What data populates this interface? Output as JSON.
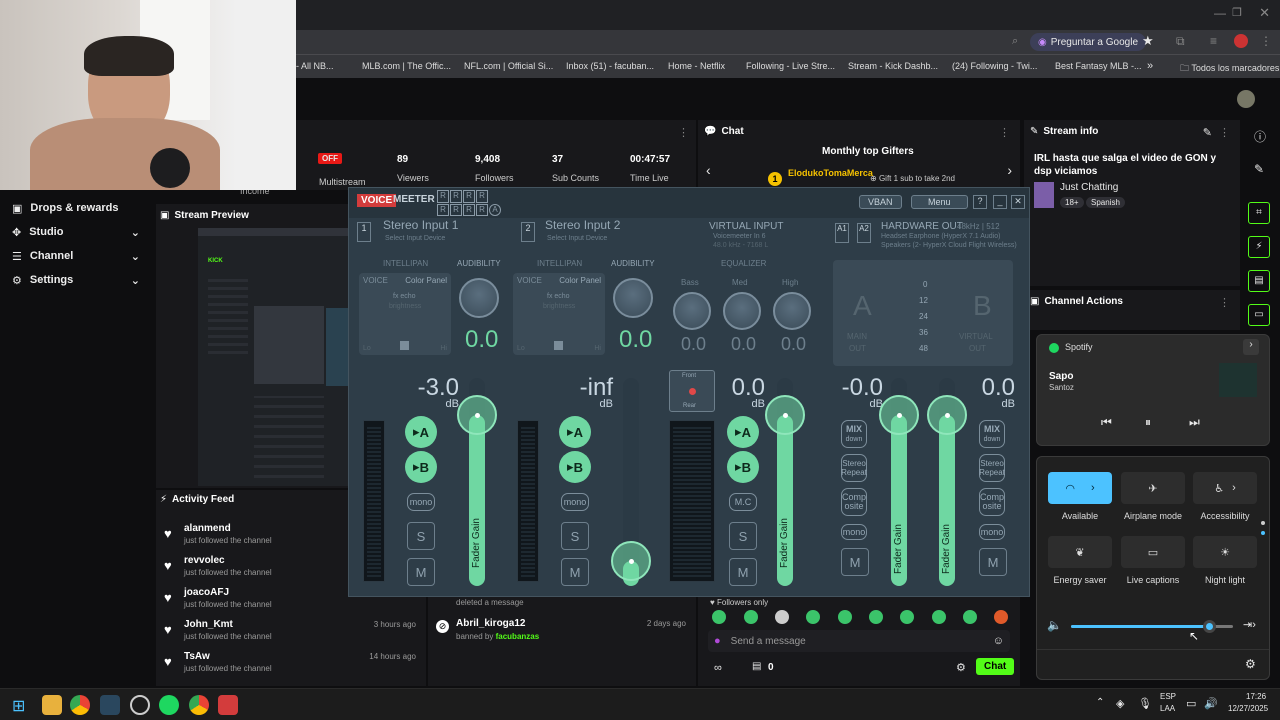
{
  "browser": {
    "ask_google": "Preguntar a Google",
    "bookmarks": [
      "- All NB...",
      "MLB.com | The Offic...",
      "NFL.com | Official Si...",
      "Inbox (51) - facuban...",
      "Home - Netflix",
      "Following - Live Stre...",
      "Stream - Kick Dashb...",
      "(24) Following - Twi...",
      "Best Fantasy MLB -..."
    ],
    "all_bookmarks": "Todos los marcadores"
  },
  "stats": {
    "income_label": "Income",
    "off_badge": "OFF",
    "multistream_label": "Multistream",
    "viewers_value": "89",
    "viewers_label": "Viewers",
    "followers_value": "9,408",
    "followers_label": "Followers",
    "subs_value": "37",
    "subs_label": "Sub Counts",
    "time_value": "00:47:57",
    "time_label": "Time Live"
  },
  "sidebar": {
    "items": [
      {
        "label": "Drops & rewards"
      },
      {
        "label": "Studio"
      },
      {
        "label": "Channel"
      },
      {
        "label": "Settings"
      }
    ]
  },
  "stream_preview": {
    "title": "Stream Preview"
  },
  "activity_feed": {
    "title": "Activity Feed",
    "items": [
      {
        "user": "alanmend",
        "action": "just followed the channel",
        "time": ""
      },
      {
        "user": "revvolec",
        "action": "just followed the channel",
        "time": ""
      },
      {
        "user": "joacoAFJ",
        "action": "just followed the channel",
        "time": ""
      },
      {
        "user": "John_Kmt",
        "action": "just followed the channel",
        "time": "3 hours ago"
      },
      {
        "user": "TsAw",
        "action": "just followed the channel",
        "time": "14 hours ago"
      }
    ]
  },
  "mod_log": {
    "deleted": "deleted a message",
    "user": "Abril_kiroga12",
    "time": "2 days ago",
    "banned_by": "banned by",
    "moderator": "facubanzas"
  },
  "chat": {
    "title": "Chat",
    "gifters_title": "Monthly top Gifters",
    "top_gifter": "ElodukoTomaMerca",
    "gift_hint": "Gift 1 sub to take 2nd",
    "followers_only": "Followers only",
    "placeholder": "Send a message",
    "points": "0",
    "send_label": "Chat"
  },
  "stream_info": {
    "title": "Stream info",
    "stream_title": "IRL hasta que salga el video de GON y dsp viciamos",
    "category": "Just Chatting",
    "tags": [
      "18+",
      "Spanish"
    ]
  },
  "channel_actions": {
    "title": "Channel Actions"
  },
  "voicemeeter": {
    "logo_a": "VOICE",
    "logo_b": "MEETER",
    "vban": "VBAN",
    "menu": "Menu",
    "inputs": [
      {
        "num": "1",
        "name": "Stereo Input 1",
        "sub": "Select Input Device",
        "db": "-3.0",
        "level": 0.82
      },
      {
        "num": "2",
        "name": "Stereo Input 2",
        "sub": "Select Input Device",
        "db": "-inf",
        "level": 0.12
      }
    ],
    "virtual_input": {
      "title": "VIRTUAL INPUT",
      "line1": "Voicemeeter In 6",
      "line2": "48.0 kHz - 7168 L",
      "db": "0.0",
      "level": 0.82
    },
    "hardware_out": {
      "title": "HARDWARE OUT",
      "spec": "48kHz | 512",
      "line1": "Headset Earphone (HyperX 7.1 Audio)",
      "line2": "Speakers (2- HyperX Cloud Flight Wireless)"
    },
    "outputs": [
      {
        "db": "-0.0",
        "level": 0.82
      },
      {
        "db": "0.0",
        "level": 0.82
      }
    ],
    "labels": {
      "intellipan": "INTELLIPAN",
      "audibility": "AUDIBILITY",
      "equalizer": "EQUALIZER",
      "voice": "VOICE",
      "color_panel": "Color Panel",
      "fx_echo": "fx echo",
      "brightness": "brightness",
      "lo": "Lo",
      "hi": "Hi",
      "bass": "Bass",
      "med": "Med",
      "high": "High",
      "db_unit": "dB",
      "fader_gain": "Fader Gain",
      "mono": "mono",
      "mc": "M.C",
      "s": "S",
      "m": "M",
      "a": "A",
      "b": "B",
      "a1": "A1",
      "a2": "A2",
      "mix": "MIX",
      "down": "down",
      "stereo": "Stereo",
      "repeat": "Repeat",
      "comp": "Comp",
      "osite": "osite",
      "front": "Front",
      "rear": "Rear",
      "main": "MAIN",
      "out": "OUT",
      "virtual": "VIRTUAL",
      "meter_ticks": [
        "0",
        "12",
        "24",
        "36",
        "48"
      ]
    },
    "aud_values": [
      "0.0",
      "0.0"
    ],
    "eq_values": [
      "0.0",
      "0.0",
      "0.0"
    ]
  },
  "spotify": {
    "app": "Spotify",
    "track": "Sapo",
    "artist": "Santoz"
  },
  "quick_settings": {
    "tiles": [
      {
        "label": "Available"
      },
      {
        "label": "Airplane mode"
      },
      {
        "label": "Accessibility"
      },
      {
        "label": "Energy saver"
      },
      {
        "label": "Live captions"
      },
      {
        "label": "Night light"
      }
    ],
    "volume": 0.85
  },
  "taskbar": {
    "lang1": "ESP",
    "lang2": "LAA",
    "time": "17:26",
    "date": "12/27/2025"
  },
  "colors": {
    "accent": "#53fc18",
    "vm_green": "#6fd7a2",
    "vm_bg": "#2e3d48",
    "win_blue": "#4cc2ff"
  }
}
